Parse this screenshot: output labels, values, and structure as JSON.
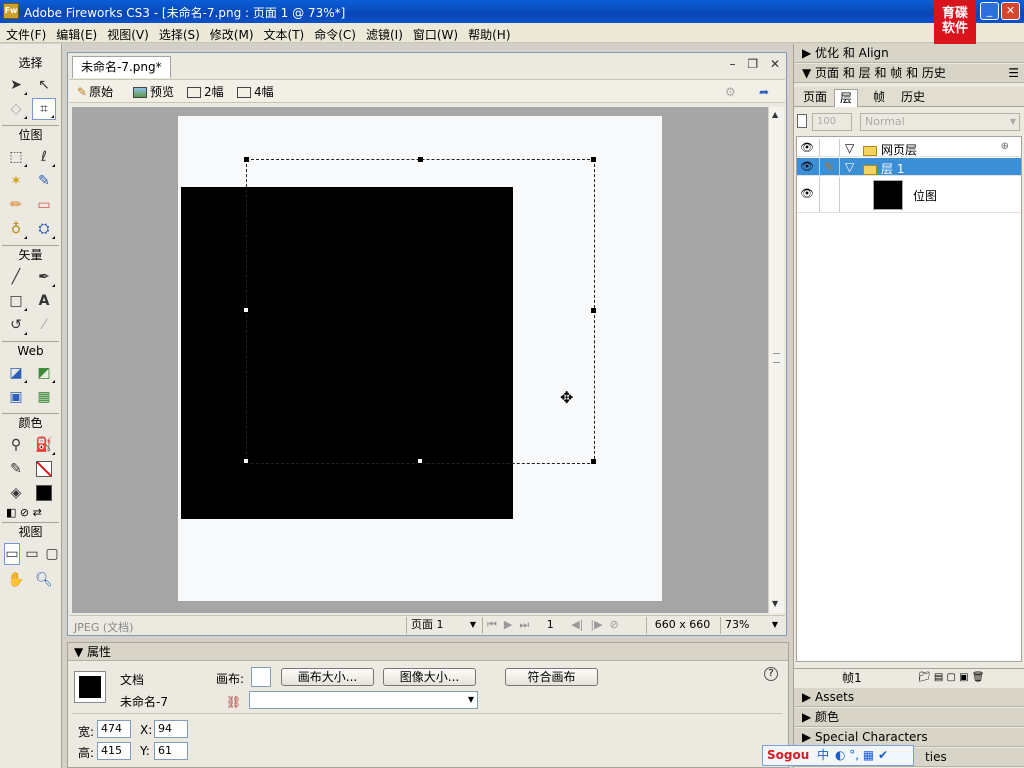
{
  "window": {
    "app_icon_label": "Fw",
    "title": "Adobe Fireworks CS3 - [未命名-7.png : 页面 1 @  73%*]",
    "logo_line1": "育碟",
    "logo_line2": "软件",
    "minimize": "_",
    "restore": "❐",
    "close": "✕"
  },
  "menu": [
    "文件(F)",
    "编辑(E)",
    "视图(V)",
    "选择(S)",
    "修改(M)",
    "文本(T)",
    "命令(C)",
    "滤镜(I)",
    "窗口(W)",
    "帮助(H)"
  ],
  "tools": {
    "select_title": "选择",
    "bitmap_title": "位图",
    "vector_title": "矢量",
    "web_title": "Web",
    "color_title": "颜色",
    "view_title": "视图"
  },
  "document": {
    "tab_label": "未命名-7.png*",
    "view_tabs": [
      "原始",
      "预览",
      "2幅",
      "4幅"
    ],
    "status_type": "JPEG (文档)",
    "page_select": "页面 1",
    "frame_number": "1",
    "canvas_size": "660 x 660",
    "zoom": "73%"
  },
  "properties": {
    "header": "属性",
    "doc_label": "文档",
    "doc_name": "未命名-7",
    "canvas_label": "画布:",
    "canvas_size_btn": "画布大小...",
    "image_size_btn": "图像大小...",
    "fit_canvas_btn": "符合画布",
    "width_label": "宽:",
    "width_value": "474",
    "height_label": "高:",
    "height_value": "415",
    "x_label": "X:",
    "x_value": "94",
    "y_label": "Y:",
    "y_value": "61",
    "help": "?"
  },
  "right_panel": {
    "optimize_header": "优化 和 Align",
    "pages_header": "页面 和 层 和 帧 和 历史",
    "tabs": [
      "页面",
      "层",
      "帧",
      "历史"
    ],
    "opacity": "100",
    "blend_mode": "Normal",
    "layers": [
      {
        "name": "网页层"
      },
      {
        "name": "层 1"
      },
      {
        "name": "位图"
      }
    ],
    "frame_label": "帧1",
    "assets_header": "Assets",
    "color_header": "颜色",
    "special_header": "Special Characters",
    "last_header": "ties"
  },
  "ime": {
    "brand": "Sogou",
    "mode": "中"
  }
}
